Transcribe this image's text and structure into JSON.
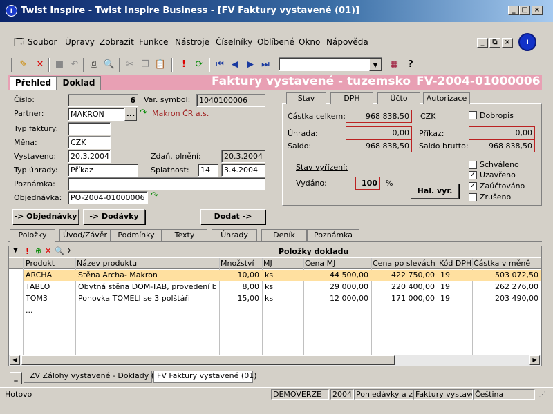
{
  "window": {
    "title": "Twist Inspire - Twist Inspire Business - [FV Faktury vystavené (01)]",
    "btn_min": "_",
    "btn_max": "□",
    "btn_close": "×"
  },
  "menu": [
    "Soubor",
    "Úpravy",
    "Zobrazit",
    "Funkce",
    "Nástroje",
    "Číselníky",
    "Oblíbené",
    "Okno",
    "Nápověda"
  ],
  "mdi_buttons": {
    "min": "_",
    "restore": "⧉",
    "close": "×"
  },
  "header": {
    "tab_prehled": "Přehled",
    "tab_doklad": "Doklad",
    "title": "Faktury vystavené - tuzemsko",
    "doc_number": "FV-2004-01000006"
  },
  "form": {
    "cislo_label": "Číslo:",
    "cislo": "6",
    "var_label": "Var. symbol:",
    "var_symbol": "1040100006",
    "partner_label": "Partner:",
    "partner": "MAKRON",
    "partner_btn": "...",
    "partner_link": "Makron ČR a.s.",
    "typ_faktury_label": "Typ faktury:",
    "typ_faktury": "",
    "mena_label": "Měna:",
    "mena": "CZK",
    "vystaveno_label": "Vystaveno:",
    "vystaveno": "20.3.2004",
    "zdan_label": "Zdaň. plnění:",
    "zdan": "20.3.2004",
    "typ_uhrady_label": "Typ úhrady:",
    "typ_uhrady": "Příkaz",
    "splatnost_label": "Splatnost:",
    "splatnost_dny": "14",
    "splatnost": "3.4.2004",
    "poznamka_label": "Poznámka:",
    "poznamka": "",
    "objednavka_label": "Objednávka:",
    "objednavka": "PO-2004-01000006"
  },
  "summary_tabs": [
    "Stav",
    "DPH",
    "Účto",
    "Autorizace"
  ],
  "summary": {
    "castka_label": "Částka celkem:",
    "castka": "968 838,50",
    "castka_mena": "CZK",
    "dobropis": "Dobropis",
    "uhrada_label": "Úhrada:",
    "uhrada": "0,00",
    "prikaz_label": "Příkaz:",
    "prikaz": "0,00",
    "saldo_label": "Saldo:",
    "saldo": "968 838,50",
    "saldo_brutto_label": "Saldo brutto:",
    "saldo_brutto": "968 838,50",
    "stav_vyrizeni": "Stav vyřízení:",
    "vydano_label": "Vydáno:",
    "vydano": "100",
    "vydano_unit": "%",
    "hal_btn": "Hal. vyr.",
    "checks": [
      {
        "label": "Schváleno",
        "checked": false
      },
      {
        "label": "Uzavřeno",
        "checked": true
      },
      {
        "label": "Zaúčtováno",
        "checked": true
      },
      {
        "label": "Zrušeno",
        "checked": false
      }
    ]
  },
  "actions": {
    "objednavky": "-> Objednávky",
    "dodavky": "-> Dodávky",
    "dodat": "Dodat ->"
  },
  "detail_tabs": [
    "Položky",
    "Úvod/Závěr",
    "Podmínky",
    "Texty",
    "Úhrady",
    "Deník",
    "Poznámka"
  ],
  "grid": {
    "title": "Položky dokladu",
    "columns": [
      "Produkt",
      "Název produktu",
      "Množství",
      "MJ",
      "Cena MJ",
      "Cena po slevách",
      "Kód DPH",
      "Částka v měně"
    ],
    "rows": [
      [
        "ARCHA",
        "Stěna Archa- Makron",
        "10,00",
        "ks",
        "44 500,00",
        "422 750,00",
        "19",
        "503 072,50"
      ],
      [
        "TABLO",
        "Obytná stěna DOM-TAB, provedení buk",
        "8,00",
        "ks",
        "29 000,00",
        "220 400,00",
        "19",
        "262 276,00"
      ],
      [
        "TOM3",
        "Pohovka TOMELI se 3 polštáři",
        "15,00",
        "ks",
        "12 000,00",
        "171 000,00",
        "19",
        "203 490,00"
      ]
    ],
    "ellipsis": "..."
  },
  "window_tabs": [
    "ZV Zálohy vystavené - Doklady (01)",
    "FV Faktury vystavené (01)"
  ],
  "status": [
    "Hotovo",
    "DEMOVERZE",
    "2004",
    "Pohledávky a záv",
    "Faktury vystavené",
    "Čeština"
  ],
  "colors": {
    "accent": "#e8a0b4",
    "title_red": "#ffffff",
    "selected_row": "#ffe0a0"
  }
}
